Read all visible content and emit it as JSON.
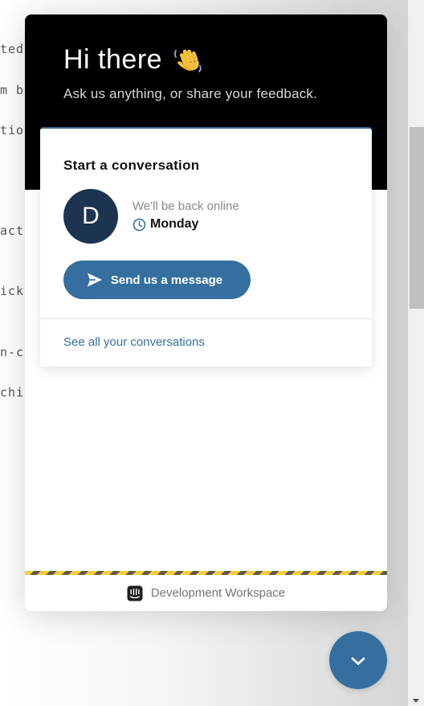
{
  "background": {
    "fragments": [
      "ted",
      "m br",
      "tion",
      "acti",
      "ick,",
      "n-co",
      "chie"
    ]
  },
  "messenger": {
    "greeting": "Hi there",
    "greeting_emoji": "waving-hand-icon",
    "intro": "Ask us anything, or share your feedback.",
    "conversation_card": {
      "title": "Start a conversation",
      "avatar_initial": "D",
      "status_text": "We'll be back online",
      "reply_time": "Monday",
      "send_button_label": "Send us a message",
      "see_all_label": "See all your conversations"
    },
    "footer": {
      "workspace_name": "Development Workspace"
    }
  },
  "colors": {
    "header_bg": "#000000",
    "accent": "#346fa0",
    "avatar_bg": "#1c3450",
    "hazard_yellow": "#f2cc3c"
  },
  "launcher": {
    "icon": "chevron-down-icon"
  }
}
